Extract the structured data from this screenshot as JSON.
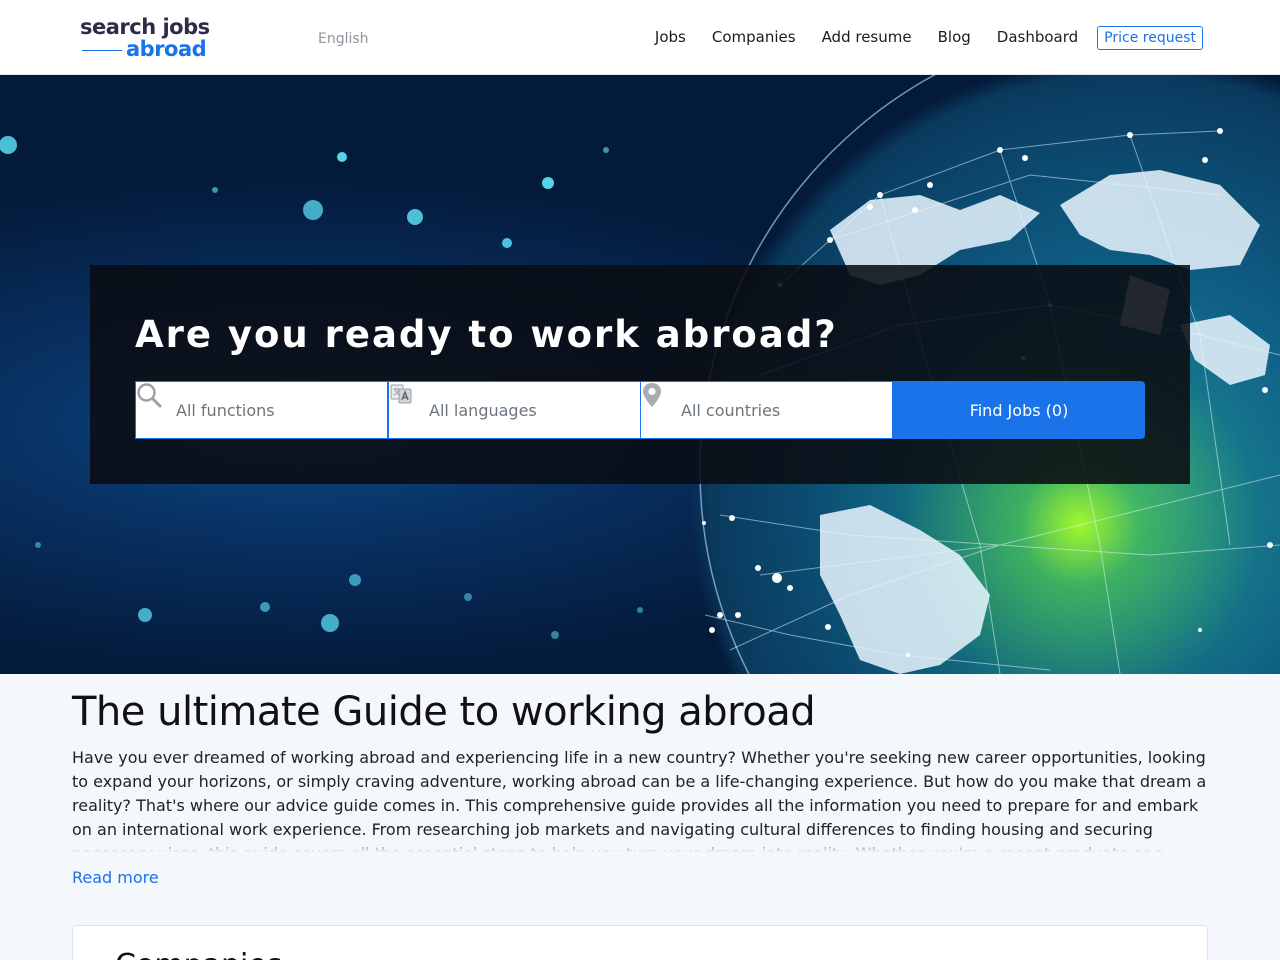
{
  "header": {
    "logo_line1": "search jobs",
    "logo_line2": "abroad",
    "language": "English",
    "nav": [
      {
        "label": "Jobs"
      },
      {
        "label": "Companies"
      },
      {
        "label": "Add resume"
      },
      {
        "label": "Blog"
      },
      {
        "label": "Dashboard"
      }
    ],
    "price_request": "Price request"
  },
  "hero": {
    "title": "Are you ready to work abroad?",
    "functions_placeholder": "All functions",
    "languages_placeholder": "All languages",
    "countries_placeholder": "All countries",
    "find_button": "Find Jobs (0)"
  },
  "guide": {
    "title": "The ultimate Guide to working abroad",
    "body": "Have you ever dreamed of working abroad and experiencing life in a new country? Whether you're seeking new career opportunities, looking to expand your horizons, or simply craving adventure, working abroad can be a life-changing experience. But how do you make that dream a reality? That's where our advice guide comes in. This comprehensive guide provides all the information you need to prepare for and embark on an international work experience. From researching job markets and navigating cultural differences to finding housing and securing necessary visas, this guide covers all the essential steps to help you turn your dream into reality. Whether you're a recent graduate or a seasoned professional, our advice guide is your go-to resource.",
    "read_more": "Read more"
  },
  "card": {
    "title": "Companies"
  },
  "colors": {
    "accent": "#1a73e8",
    "logo_dark": "#2d2a4a",
    "panel": "#0a0c12"
  },
  "icons": {
    "functions": "search-icon",
    "languages": "translate-icon",
    "countries": "location-pin-icon"
  }
}
